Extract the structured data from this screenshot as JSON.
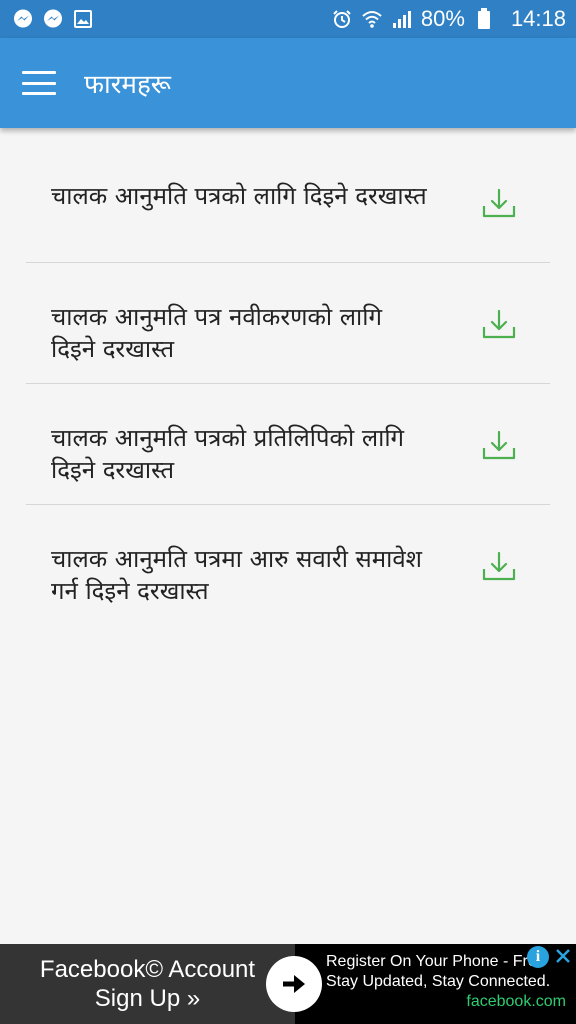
{
  "status_bar": {
    "battery": "80%",
    "time": "14:18",
    "icons": [
      "messenger-icon",
      "messenger-icon",
      "image-icon",
      "alarm-icon",
      "wifi-icon",
      "signal-icon",
      "battery-icon"
    ]
  },
  "app_bar": {
    "title": "फारमहरू",
    "menu_icon": "hamburger-menu-icon"
  },
  "forms": [
    {
      "title": "चालक आनुमति पत्रको लागि दिइने दरखास्त",
      "icon": "download-icon"
    },
    {
      "title": "चालक आनुमति पत्र नवीकरणको लागि दिइने दरखास्त",
      "icon": "download-icon"
    },
    {
      "title": "चालक आनुमति पत्रको प्रतिलिपिको लागि दिइने दरखास्त",
      "icon": "download-icon"
    },
    {
      "title": "चालक आनुमति पत्रमा आरु सवारी समावेश गर्न दिइने दरखास्त",
      "icon": "download-icon"
    }
  ],
  "ad": {
    "left_line1": "Facebook© Account",
    "left_line2": "Sign Up »",
    "right_line1": "Register On Your Phone - Free",
    "right_line2": "Stay Updated, Stay Connected.",
    "domain": "facebook.com"
  },
  "colors": {
    "status_bar": "#2f80c5",
    "app_bar": "#3a92d8",
    "download_icon": "#4caf50",
    "background": "#f5f5f5"
  }
}
